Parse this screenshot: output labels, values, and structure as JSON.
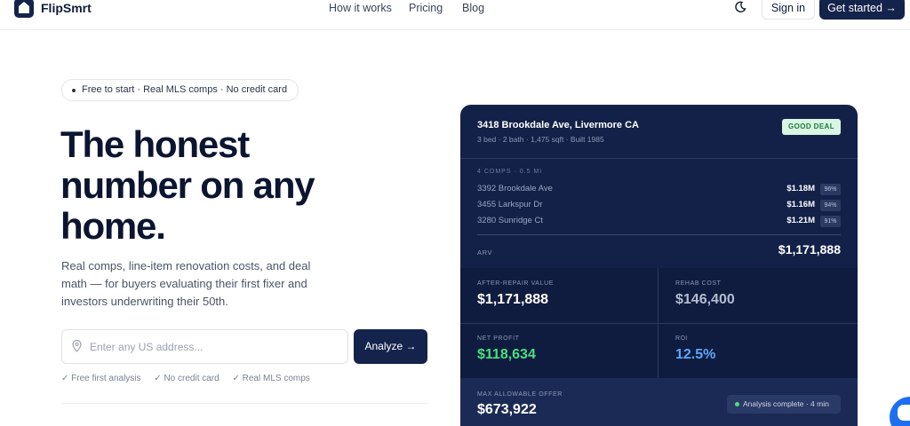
{
  "header": {
    "brand": "FlipSmrt",
    "nav": [
      "How it works",
      "Pricing",
      "Blog"
    ],
    "signin_label": "Sign in",
    "cta_label": "Get started →"
  },
  "hero": {
    "pill_text": "Free to start · Real MLS comps · No credit card",
    "title": "The honest number on any home.",
    "subtitle": "Real comps, line-item renovation costs, and deal math — for buyers evaluating their first fixer and investors underwriting their 50th.",
    "address_placeholder": "Enter any US address...",
    "analyze_label": "Analyze →",
    "checks": [
      "✓ Free first analysis",
      "✓ No credit card",
      "✓ Real MLS comps"
    ]
  },
  "card": {
    "address": "3418 Brookdale Ave, Livermore CA",
    "meta": "3 bed · 2 bath · 1,475 sqft · Built 1985",
    "badge": "GOOD DEAL",
    "comps_header": "4 COMPS · 0.5 MI",
    "comps": [
      {
        "address": "3392 Brookdale Ave",
        "price": "$1.18M",
        "match": "96%"
      },
      {
        "address": "3455 Larkspur Dr",
        "price": "$1.16M",
        "match": "94%"
      },
      {
        "address": "3280 Sunridge Ct",
        "price": "$1.21M",
        "match": "91%"
      }
    ],
    "arv_label": "ARV",
    "arv_value": "$1,171,888",
    "metrics": [
      {
        "label": "AFTER-REPAIR VALUE",
        "value": "$1,171,888"
      },
      {
        "label": "REHAB COST",
        "value": "$146,400"
      },
      {
        "label": "NET PROFIT",
        "value": "$118,634"
      },
      {
        "label": "ROI",
        "value": "12.5%"
      }
    ],
    "mao_label": "MAX ALLOWABLE OFFER",
    "mao_value": "$673,922",
    "status": "Analysis complete · 4 min"
  },
  "colors": {
    "navy": "#14234b",
    "card_bg": "#132148",
    "profit_green": "#4ade80",
    "roi_blue": "#60a5fa",
    "badge_bg": "#d9f5e3"
  },
  "icons": [
    "home-icon",
    "moon-icon",
    "location-pin-icon",
    "chat-icon"
  ]
}
